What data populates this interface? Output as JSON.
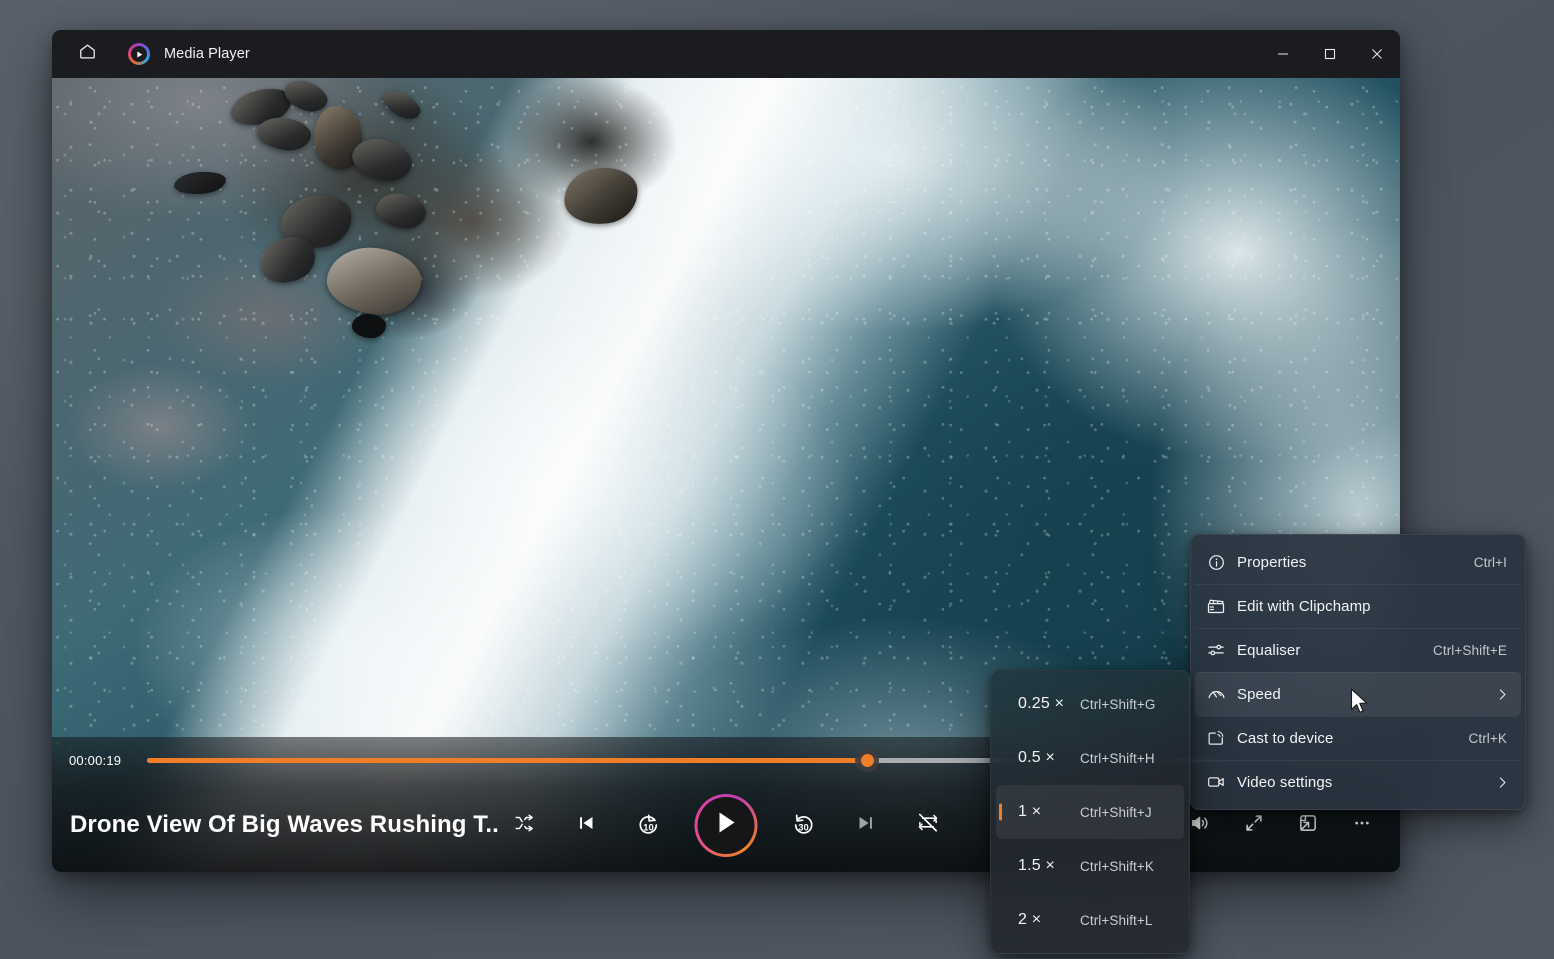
{
  "window": {
    "title": "Media Player",
    "home_icon": "home-icon",
    "app_logo": "media-player-logo-icon",
    "controls": {
      "minimize": "minimize-icon",
      "maximize": "maximize-icon",
      "close": "close-icon"
    }
  },
  "player": {
    "media_title": "Drone View Of Big Waves Rushing T...",
    "current_time": "00:00:19",
    "progress_percent": 58.5,
    "accent_color": "#f07d28",
    "transport": [
      {
        "name": "shuffle-icon",
        "label": "Shuffle"
      },
      {
        "name": "previous-icon",
        "label": "Previous"
      },
      {
        "name": "rewind-10-icon",
        "label": "10"
      },
      {
        "name": "play-icon",
        "label": "Play"
      },
      {
        "name": "forward-30-icon",
        "label": "30"
      },
      {
        "name": "next-icon",
        "label": "Next"
      },
      {
        "name": "repeat-off-icon",
        "label": "Repeat off"
      }
    ],
    "right_controls": [
      {
        "name": "volume-icon",
        "label": "Volume"
      },
      {
        "name": "fullscreen-icon",
        "label": "Full screen"
      },
      {
        "name": "mini-player-icon",
        "label": "Mini player"
      },
      {
        "name": "more-options-icon",
        "label": "More options"
      }
    ]
  },
  "context_menu": {
    "items": [
      {
        "icon": "info-circle-icon",
        "label": "Properties",
        "accel": "Ctrl+I",
        "submenu": false,
        "highlighted": false
      },
      {
        "icon": "clipchamp-icon",
        "label": "Edit with Clipchamp",
        "accel": "",
        "submenu": false,
        "highlighted": false
      },
      {
        "icon": "equaliser-icon",
        "label": "Equaliser",
        "accel": "Ctrl+Shift+E",
        "submenu": false,
        "highlighted": false
      },
      {
        "icon": "speed-gauge-icon",
        "label": "Speed",
        "accel": "",
        "submenu": true,
        "highlighted": true
      },
      {
        "icon": "cast-icon",
        "label": "Cast to device",
        "accel": "Ctrl+K",
        "submenu": false,
        "highlighted": false
      },
      {
        "icon": "video-camera-icon",
        "label": "Video settings",
        "accel": "",
        "submenu": true,
        "highlighted": false
      }
    ]
  },
  "speed_submenu": {
    "items": [
      {
        "label": "0.25 ×",
        "accel": "Ctrl+Shift+G",
        "selected": false
      },
      {
        "label": "0.5 ×",
        "accel": "Ctrl+Shift+H",
        "selected": false
      },
      {
        "label": "1 ×",
        "accel": "Ctrl+Shift+J",
        "selected": true
      },
      {
        "label": "1.5 ×",
        "accel": "Ctrl+Shift+K",
        "selected": false
      },
      {
        "label": "2 ×",
        "accel": "Ctrl+Shift+L",
        "selected": false
      }
    ]
  }
}
